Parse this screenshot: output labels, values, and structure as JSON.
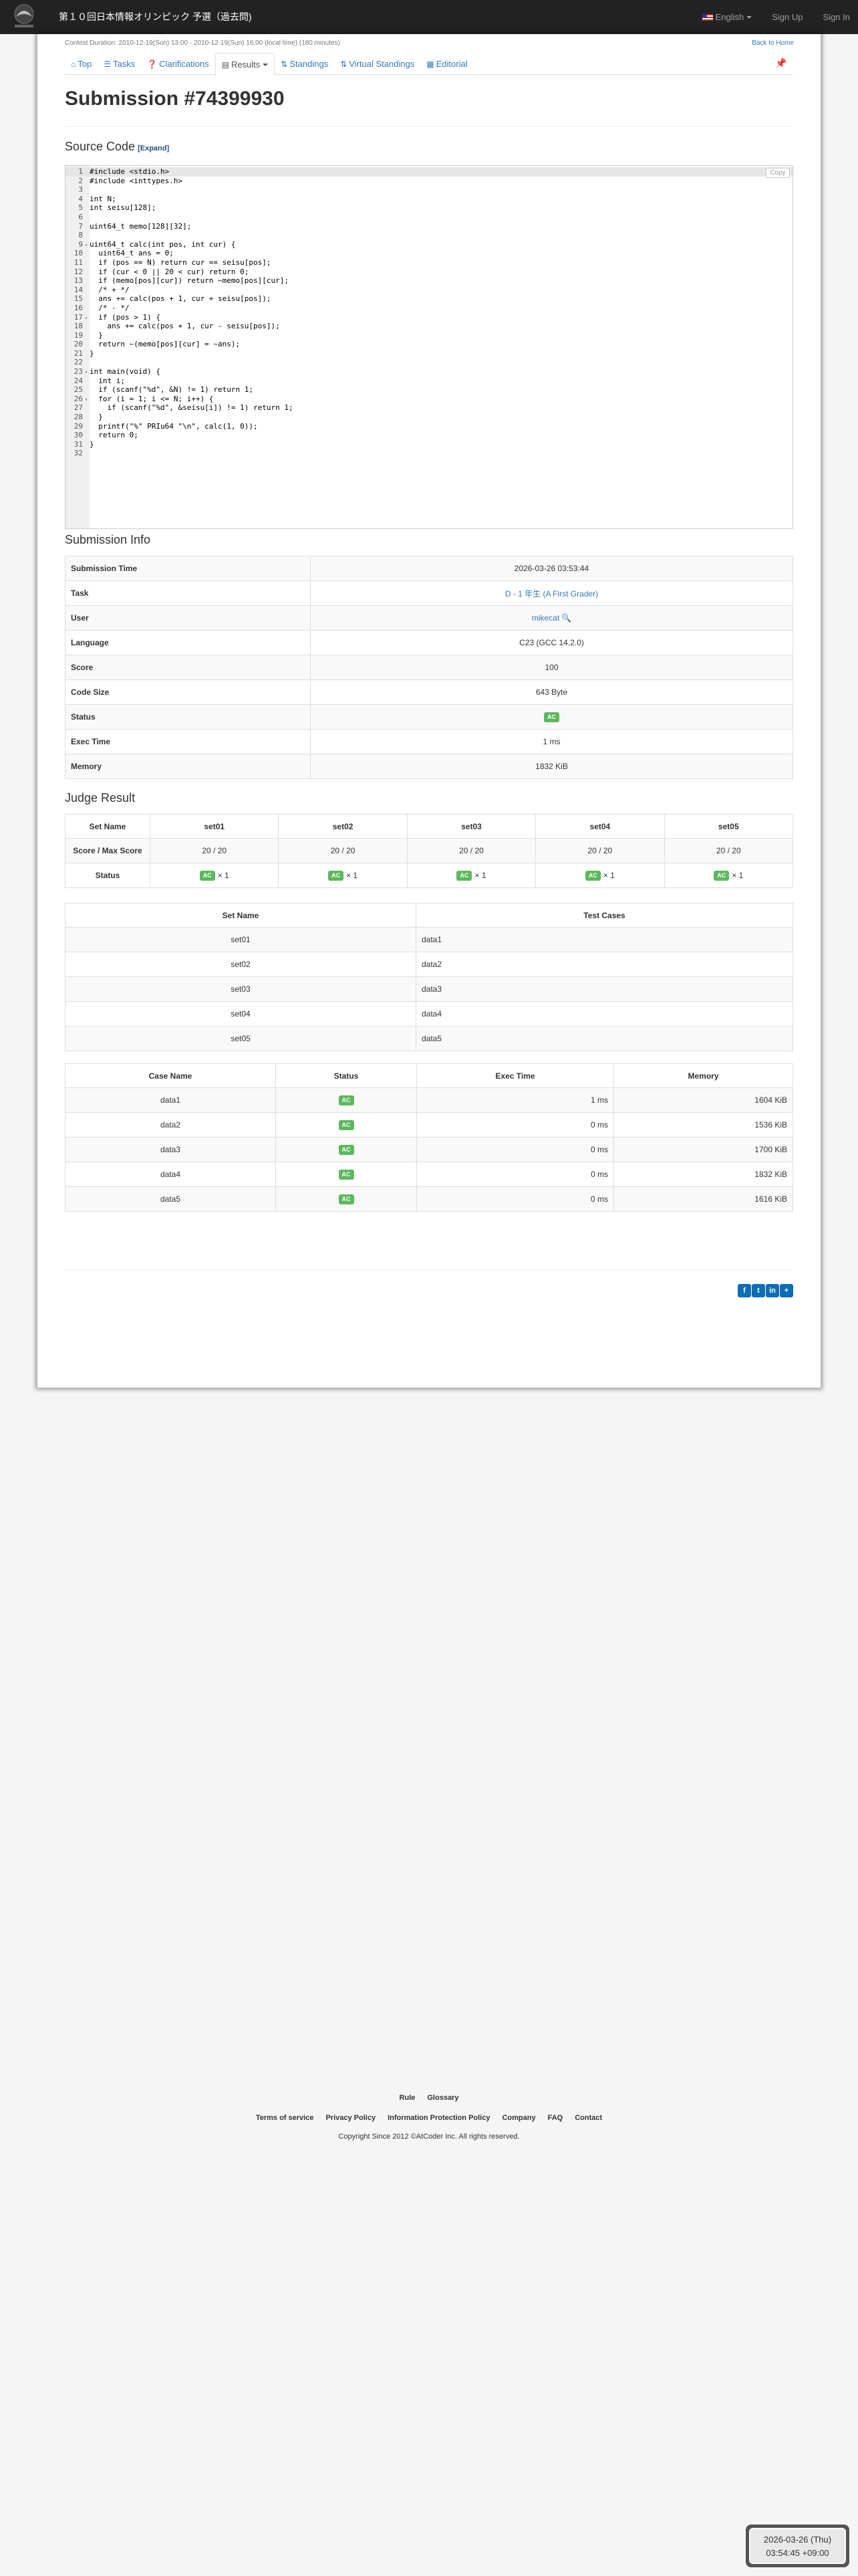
{
  "navbar": {
    "title": "第１０回日本情報オリンピック 予選（過去問)",
    "language": "English",
    "sign_up": "Sign Up",
    "sign_in": "Sign In"
  },
  "contest": {
    "duration": "Contest Duration: 2010-12-19(Sun) 13:00 - 2010-12-19(Sun) 16:00 (local time) (180 minutes)",
    "back_home": "Back to Home"
  },
  "tabs": [
    {
      "icon": "home-icon",
      "label": "Top"
    },
    {
      "icon": "tasks-icon",
      "label": "Tasks"
    },
    {
      "icon": "question-icon",
      "label": "Clarifications"
    },
    {
      "icon": "list-icon",
      "label": "Results"
    },
    {
      "icon": "sort-icon",
      "label": "Standings"
    },
    {
      "icon": "sort-icon",
      "label": "Virtual Standings"
    },
    {
      "icon": "book-icon",
      "label": "Editorial"
    }
  ],
  "page_title": "Submission #74399930",
  "source_code": {
    "heading": "Source Code",
    "expand": "[Expand]",
    "copy": "Copy",
    "lines": [
      "#include <stdio.h>",
      "#include <inttypes.h>",
      "",
      "int N;",
      "int seisu[128];",
      "",
      "uint64_t memo[128][32];",
      "",
      "uint64_t calc(int pos, int cur) {",
      "  uint64_t ans = 0;",
      "  if (pos == N) return cur == seisu[pos];",
      "  if (cur < 0 || 20 < cur) return 0;",
      "  if (memo[pos][cur]) return ~memo[pos][cur];",
      "  /* + */",
      "  ans += calc(pos + 1, cur + seisu[pos]);",
      "  /* - */",
      "  if (pos > 1) {",
      "    ans += calc(pos + 1, cur - seisu[pos]);",
      "  }",
      "  return ~(memo[pos][cur] = ~ans);",
      "}",
      "",
      "int main(void) {",
      "  int i;",
      "  if (scanf(\"%d\", &N) != 1) return 1;",
      "  for (i = 1; i <= N; i++) {",
      "    if (scanf(\"%d\", &seisu[i]) != 1) return 1;",
      "  }",
      "  printf(\"%\" PRIu64 \"\\n\", calc(1, 0));",
      "  return 0;",
      "}",
      ""
    ]
  },
  "submission_info": {
    "heading": "Submission Info",
    "rows": [
      {
        "label": "Submission Time",
        "value": "2026-03-26 03:53:44"
      },
      {
        "label": "Task",
        "value": "D - 1 年生 (A First Grader)"
      },
      {
        "label": "User",
        "value": "mikecat"
      },
      {
        "label": "Language",
        "value": "C23 (GCC 14.2.0)"
      },
      {
        "label": "Score",
        "value": "100"
      },
      {
        "label": "Code Size",
        "value": "643 Byte"
      },
      {
        "label": "Status",
        "value": "AC"
      },
      {
        "label": "Exec Time",
        "value": "1 ms"
      },
      {
        "label": "Memory",
        "value": "1832 KiB"
      }
    ]
  },
  "judge_result": {
    "heading": "Judge Result",
    "row_labels": {
      "set_name": "Set Name",
      "score": "Score / Max Score",
      "status": "Status"
    },
    "sets": [
      {
        "name": "set01",
        "score": "20 / 20",
        "status": "AC",
        "count": "× 1"
      },
      {
        "name": "set02",
        "score": "20 / 20",
        "status": "AC",
        "count": "× 1"
      },
      {
        "name": "set03",
        "score": "20 / 20",
        "status": "AC",
        "count": "× 1"
      },
      {
        "name": "set04",
        "score": "20 / 20",
        "status": "AC",
        "count": "× 1"
      },
      {
        "name": "set05",
        "score": "20 / 20",
        "status": "AC",
        "count": "× 1"
      }
    ]
  },
  "set_table": {
    "headers": [
      "Set Name",
      "Test Cases"
    ],
    "rows": [
      [
        "set01",
        "data1"
      ],
      [
        "set02",
        "data2"
      ],
      [
        "set03",
        "data3"
      ],
      [
        "set04",
        "data4"
      ],
      [
        "set05",
        "data5"
      ]
    ]
  },
  "case_table": {
    "headers": [
      "Case Name",
      "Status",
      "Exec Time",
      "Memory"
    ],
    "rows": [
      [
        "data1",
        "AC",
        "1 ms",
        "1604 KiB"
      ],
      [
        "data2",
        "AC",
        "0 ms",
        "1536 KiB"
      ],
      [
        "data3",
        "AC",
        "0 ms",
        "1700 KiB"
      ],
      [
        "data4",
        "AC",
        "0 ms",
        "1832 KiB"
      ],
      [
        "data5",
        "AC",
        "0 ms",
        "1616 KiB"
      ]
    ]
  },
  "share": [
    "f",
    "t",
    "in",
    "+"
  ],
  "footer": {
    "row1": [
      "Rule",
      "Glossary"
    ],
    "row2": [
      "Terms of service",
      "Privacy Policy",
      "Information Protection Policy",
      "Company",
      "FAQ",
      "Contact"
    ],
    "copyright": "Copyright Since 2012 ©AtCoder Inc. All rights reserved."
  },
  "clock": {
    "date": "2026-03-26 (Thu)",
    "time": "03:54:45 +09:00"
  },
  "colors": {
    "navbar": "#222222",
    "link": "#337ab7",
    "ac_badge": "#5cb85c"
  }
}
